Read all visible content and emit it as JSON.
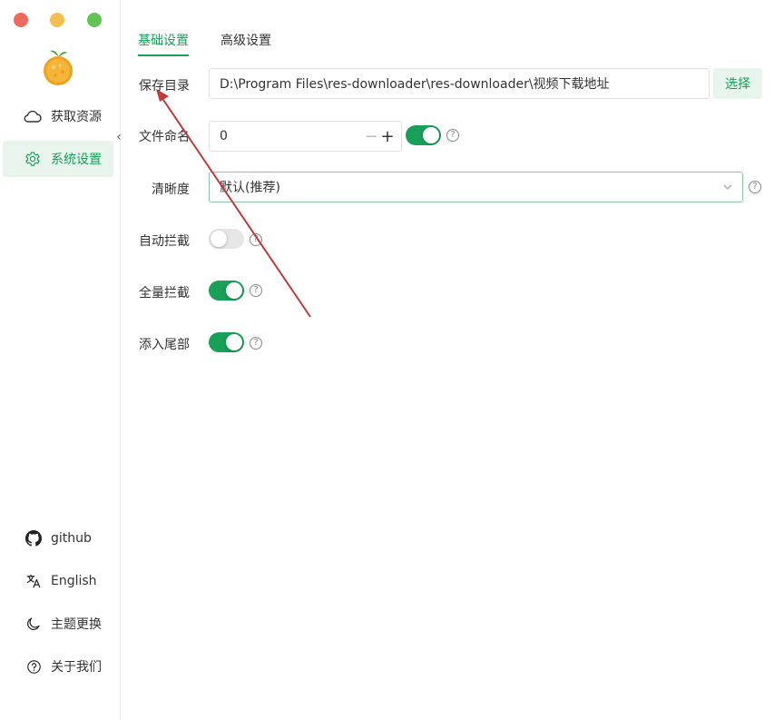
{
  "sidebar": {
    "nav": [
      {
        "label": "获取资源",
        "icon": "cloud-icon",
        "active": false
      },
      {
        "label": "系统设置",
        "icon": "gear-icon",
        "active": true
      }
    ],
    "collapse_glyph": "‹",
    "bottom": [
      {
        "label": "github",
        "icon": "github-icon"
      },
      {
        "label": "English",
        "icon": "translate-icon"
      },
      {
        "label": "主题更换",
        "icon": "moon-icon"
      },
      {
        "label": "关于我们",
        "icon": "question-circle-icon"
      }
    ]
  },
  "tabs": [
    {
      "label": "基础设置",
      "active": true
    },
    {
      "label": "高级设置",
      "active": false
    }
  ],
  "form": {
    "save_dir": {
      "label": "保存目录",
      "value": "D:\\Program Files\\res-downloader\\res-downloader\\视频下载地址",
      "button": "选择"
    },
    "file_name": {
      "label": "文件命名",
      "value": "0",
      "minus": "−",
      "plus": "+",
      "switch_on": true
    },
    "quality": {
      "label": "清晰度",
      "value": "默认(推荐)"
    },
    "auto_intercept": {
      "label": "自动拦截",
      "switch_on": false
    },
    "full_intercept": {
      "label": "全量拦截",
      "switch_on": true
    },
    "add_tail": {
      "label": "添入尾部",
      "switch_on": true
    },
    "help_glyph": "?"
  },
  "colors": {
    "accent": "#18a058",
    "accent_light": "#e7f5ec",
    "arrow": "#c0393b"
  }
}
